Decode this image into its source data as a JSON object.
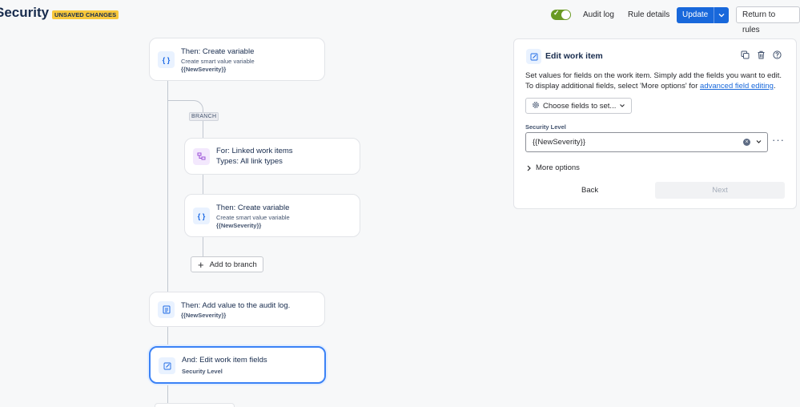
{
  "header": {
    "title": "Security",
    "badge": "UNSAVED CHANGES",
    "audit_log": "Audit log",
    "rule_details": "Rule details",
    "update": "Update",
    "return": "Return to rules"
  },
  "flow": {
    "card1": {
      "title": "Then: Create variable",
      "sub": "Create smart value variable",
      "value": "{{NewSeverity}}"
    },
    "branch_label": "BRANCH",
    "card2": {
      "title": "For: Linked work items",
      "sub": "Types: All link types"
    },
    "card3": {
      "title": "Then: Create variable",
      "sub": "Create smart value variable",
      "value": "{{NewSeverity}}"
    },
    "add_branch": "Add to branch",
    "card4": {
      "title": "Then: Add value to the audit log.",
      "value": "{{NewSeverity}}"
    },
    "card5": {
      "title": "And: Edit work item fields",
      "value": "Security Level"
    }
  },
  "panel": {
    "title": "Edit work item",
    "desc_1": "Set values for fields on the work item. Simply add the fields you want to edit. To display additional fields, select 'More options' for ",
    "desc_link": "advanced field editing",
    "desc_end": ".",
    "choose": "Choose fields to set...",
    "field_label": "Security Level",
    "field_value": "{{NewSeverity}}",
    "more_options": "More options",
    "back": "Back",
    "next": "Next"
  },
  "colors": {
    "accent": "#1868db",
    "badge": "#f8c83c",
    "toggle": "#6a9a23",
    "selected_border": "#3b82f6"
  }
}
